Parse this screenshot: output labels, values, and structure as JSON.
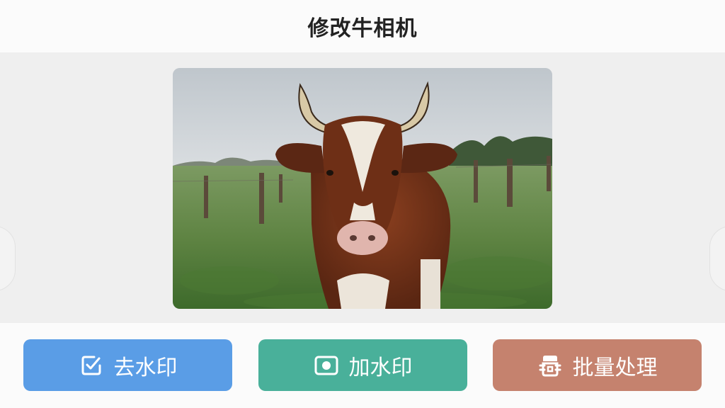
{
  "header": {
    "title": "修改牛相机"
  },
  "preview": {
    "image_subject": "cow-photo"
  },
  "actions": {
    "remove_watermark": {
      "label": "去水印",
      "icon": "checkbox-icon",
      "color": "#5a9de6"
    },
    "add_watermark": {
      "label": "加水印",
      "icon": "record-icon",
      "color": "#49b09a"
    },
    "batch_process": {
      "label": "批量处理",
      "icon": "batch-icon",
      "color": "#c5826e"
    }
  }
}
